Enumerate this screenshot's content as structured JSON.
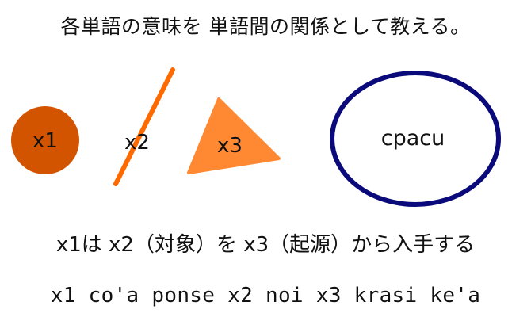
{
  "title": "各単語の意味を 単語間の関係として教える。",
  "places": {
    "x1": "x1",
    "x2": "x2",
    "x3": "x3",
    "cmavo": "cpacu"
  },
  "colors": {
    "x1_circle": "#d35400",
    "x2_line": "#ff6a00",
    "x3_triangle": "#ff8833",
    "ellipse_stroke": "#0a0a7a"
  },
  "place_structure": "x1は x2（対象）を x3（起源）から入手する",
  "lojban_sentence": "x1 co'a ponse x2 noi x3 krasi ke'a"
}
